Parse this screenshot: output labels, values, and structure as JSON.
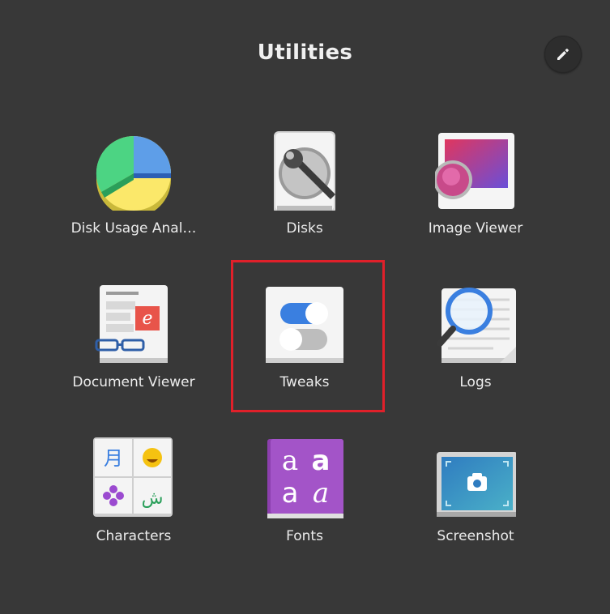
{
  "folder": {
    "title": "Utilities"
  },
  "header": {
    "edit_icon": "pencil-icon"
  },
  "apps": [
    {
      "label": "Disk Usage Anal…",
      "icon": "disk-usage-analyzer-icon"
    },
    {
      "label": "Disks",
      "icon": "disks-icon"
    },
    {
      "label": "Image Viewer",
      "icon": "image-viewer-icon"
    },
    {
      "label": "Document Viewer",
      "icon": "document-viewer-icon"
    },
    {
      "label": "Tweaks",
      "icon": "tweaks-icon"
    },
    {
      "label": "Logs",
      "icon": "logs-icon"
    },
    {
      "label": "Characters",
      "icon": "characters-icon"
    },
    {
      "label": "Fonts",
      "icon": "fonts-icon"
    },
    {
      "label": "Screenshot",
      "icon": "screenshot-icon"
    }
  ],
  "colors": {
    "background": "#383838",
    "highlight": "#e0202a"
  }
}
